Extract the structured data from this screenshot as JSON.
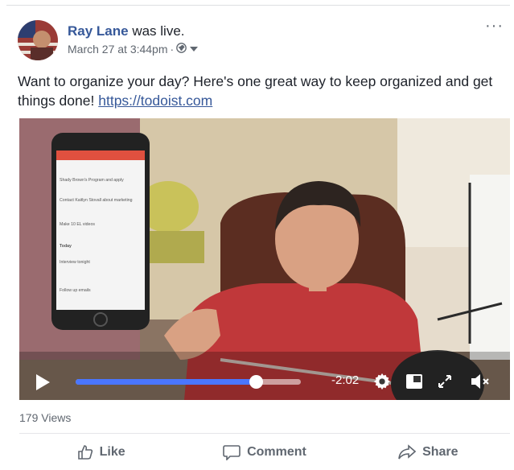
{
  "post": {
    "author": "Ray Lane",
    "status_text": "was live.",
    "timestamp": "March 27 at 3:44pm",
    "privacy_separator": "·",
    "more_label": "···",
    "text": "Want to organize your day? Here's one great way to keep organized and get things done!",
    "link": "https://todoist.com"
  },
  "video": {
    "time_remaining": "-2:02",
    "progress_fraction": 0.8,
    "phone_tasks": [
      "Shady Brown's Program and apply",
      "Contact Kaitlyn Stovall about marketing",
      "Make 10 EL videos",
      "Today",
      "Interview tonight",
      "Follow up emails"
    ]
  },
  "stats": {
    "views": "179 Views"
  },
  "actions": {
    "like": "Like",
    "comment": "Comment",
    "share": "Share"
  },
  "colors": {
    "link": "#365899",
    "progress": "#4a76ff",
    "meta": "#606770"
  }
}
